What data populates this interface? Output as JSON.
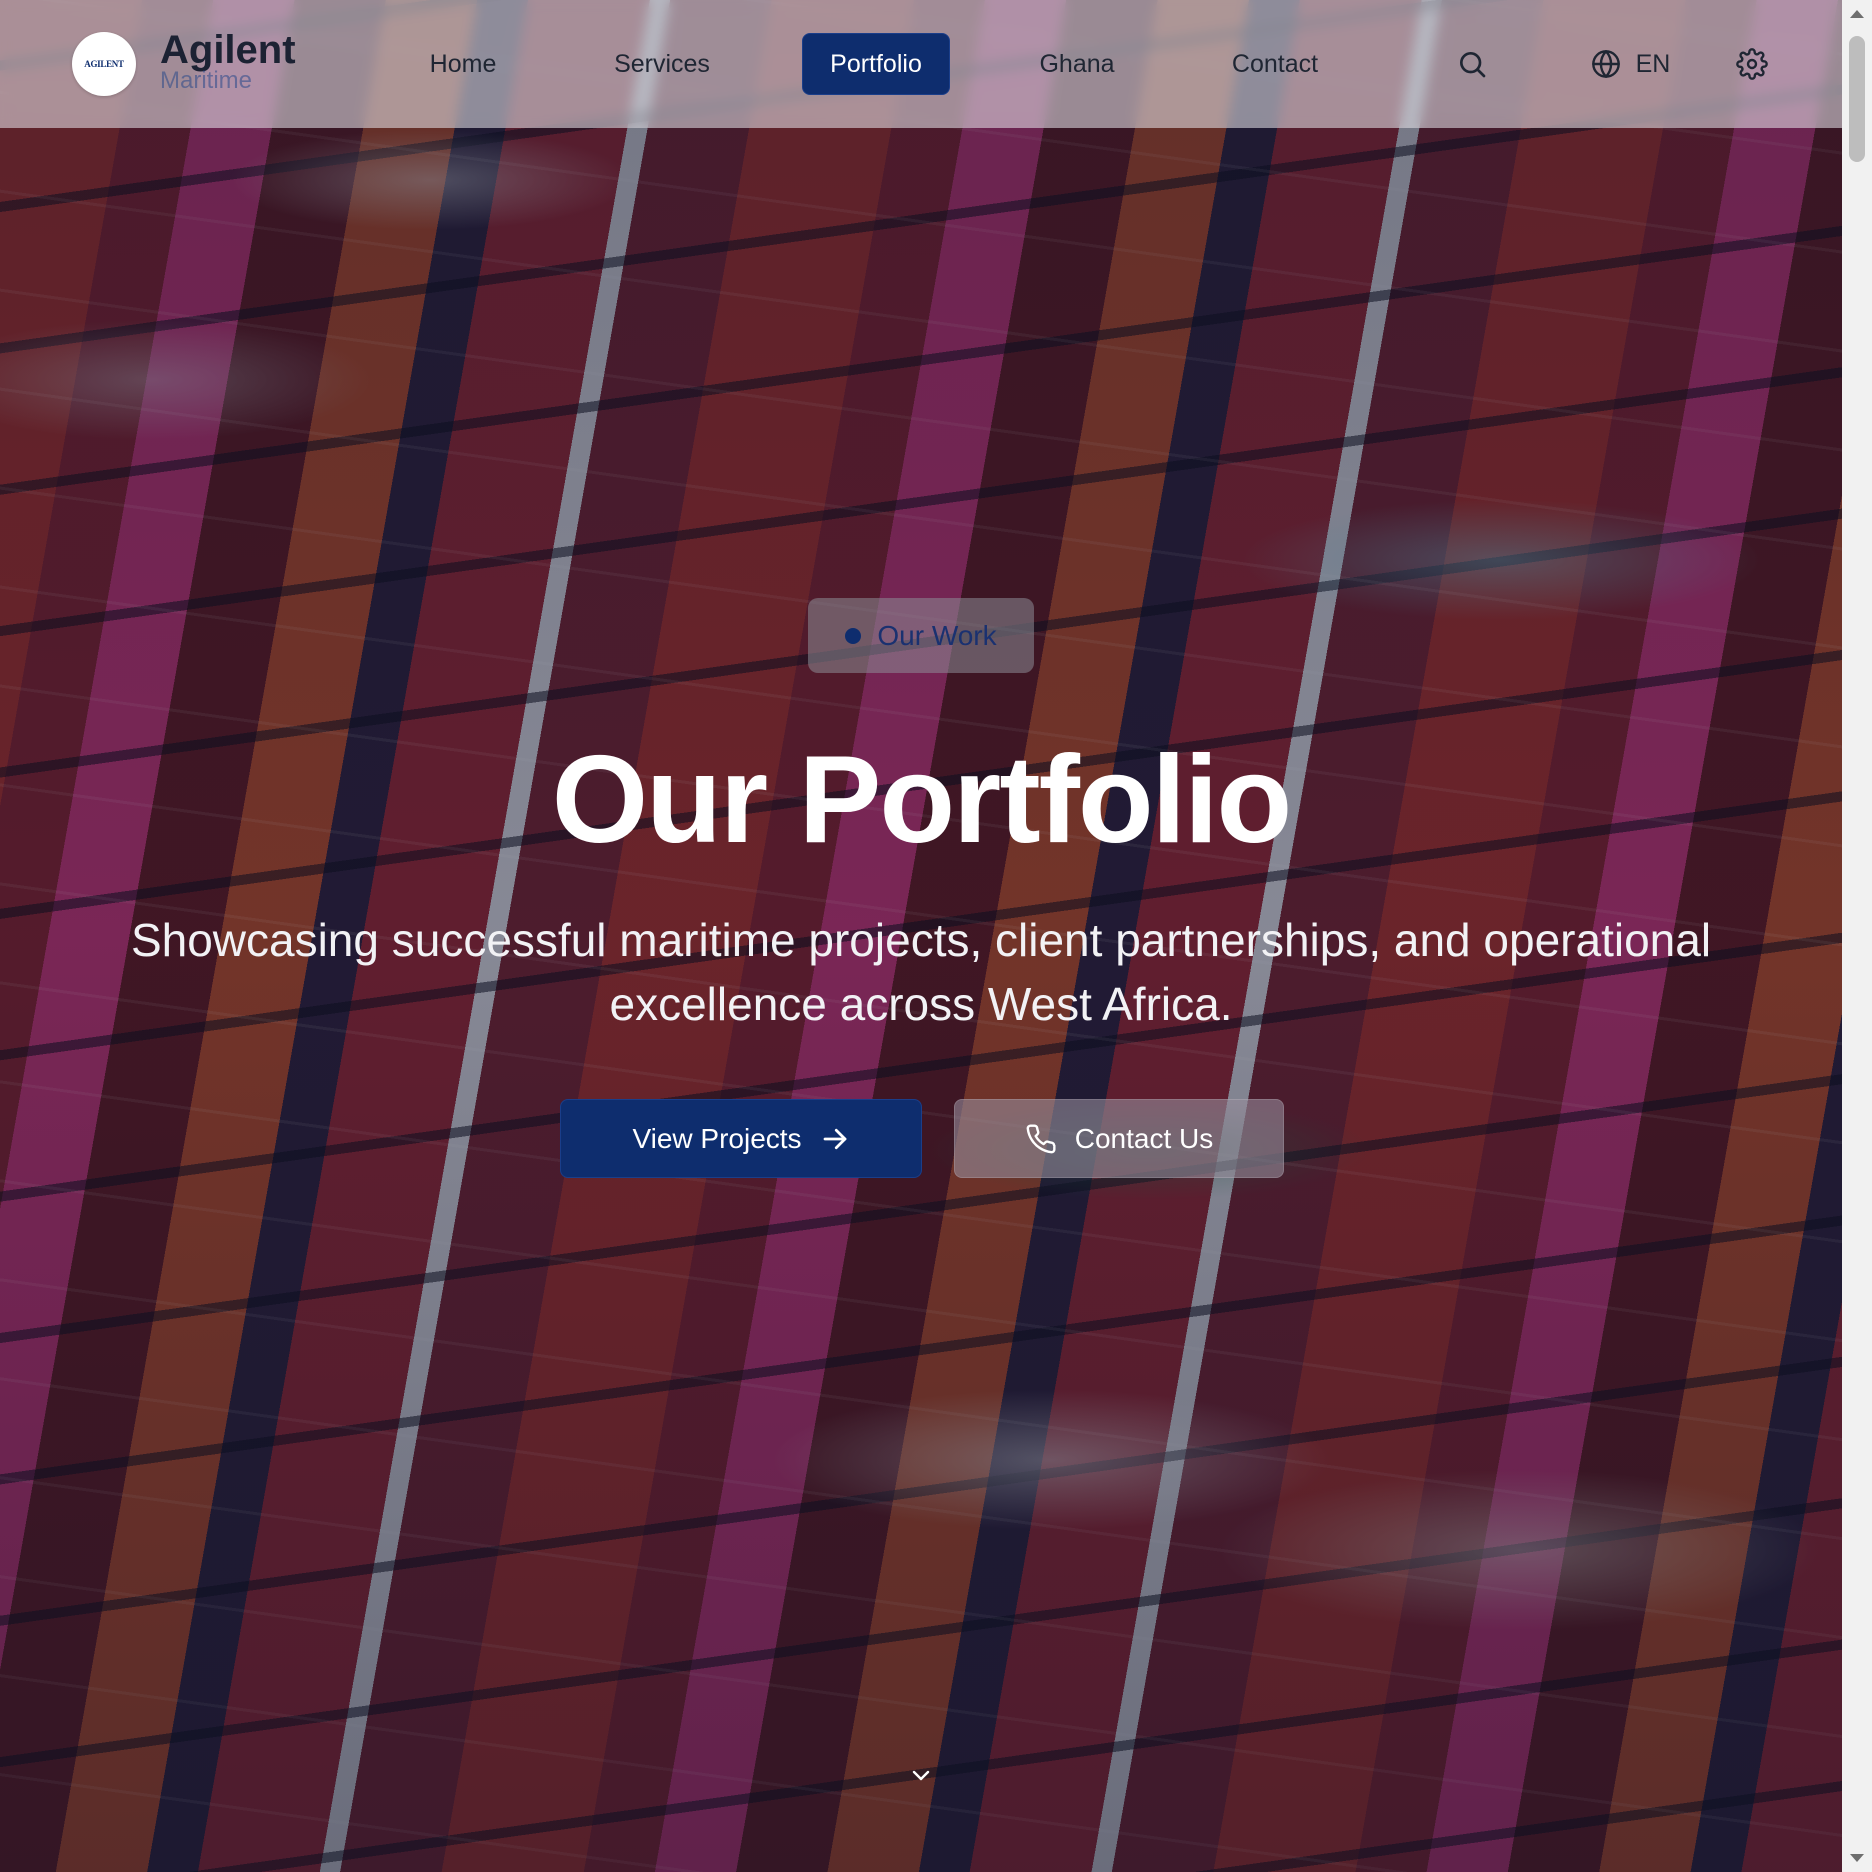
{
  "header": {
    "brand_name": "Agilent",
    "brand_sub": "Maritime",
    "logo_text": "AGILENT",
    "nav": [
      {
        "label": "Home",
        "active": false
      },
      {
        "label": "Services",
        "active": false
      },
      {
        "label": "Portfolio",
        "active": true
      },
      {
        "label": "Ghana",
        "active": false
      },
      {
        "label": "Contact",
        "active": false
      }
    ],
    "language": "EN",
    "icons": {
      "search": "search-icon",
      "language": "globe-icon",
      "settings": "gear-icon"
    }
  },
  "hero": {
    "badge": "Our Work",
    "title": "Our Portfolio",
    "subtitle": "Showcasing successful maritime projects, client partnerships, and operational excellence across West Africa.",
    "primary_button": "View Projects",
    "secondary_button": "Contact Us",
    "primary_icon": "arrow-right-icon",
    "secondary_icon": "phone-icon",
    "scroll_icon": "chevron-down-icon"
  },
  "colors": {
    "accent": "#0e2d6e",
    "text_light": "#ffffff",
    "header_bg": "rgba(235,235,240,0.55)"
  }
}
